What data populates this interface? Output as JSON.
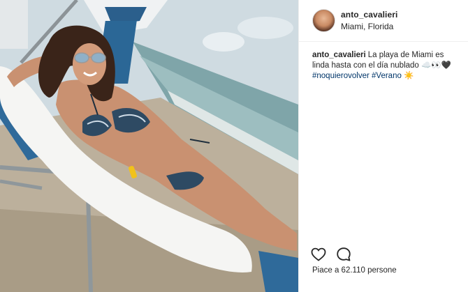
{
  "post": {
    "photo": {
      "alt_colors": {
        "sky": "#cdd9df",
        "sea": "#7fa3a8",
        "sand": "#b8aa94",
        "towel": "#f4f4f2",
        "chair_blue": "#2f6a9a",
        "skin": "#c98f6c",
        "hair": "#3a2419"
      }
    },
    "header": {
      "username": "anto_cavalieri",
      "location": "Miami, Florida"
    },
    "caption": {
      "username": "anto_cavalieri",
      "text": "La playa de Miami es linda hasta con el día nublado ☁️👀🖤",
      "hashtags": "#noquierovolver #Verano ☀️"
    },
    "actions": {
      "like_icon": "heart-icon",
      "comment_icon": "comment-icon"
    },
    "likes": {
      "text": "Piace a 62.110 persone"
    }
  }
}
